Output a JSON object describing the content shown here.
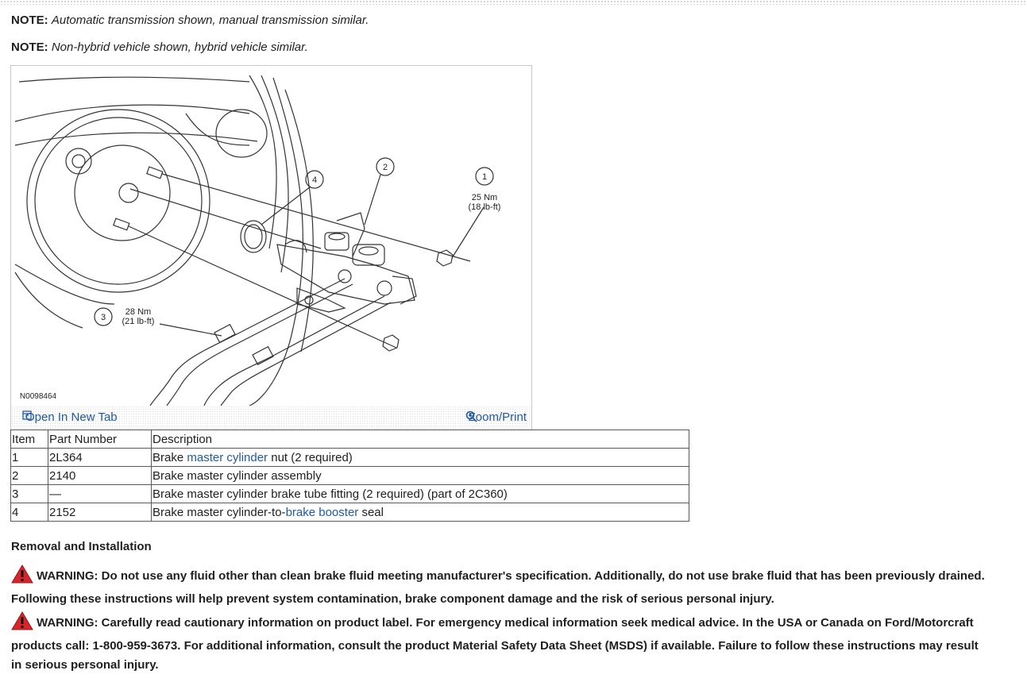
{
  "notes": [
    {
      "label": "NOTE:",
      "text": "Automatic transmission shown, manual transmission similar."
    },
    {
      "label": "NOTE:",
      "text": "Non-hybrid vehicle shown, hybrid vehicle similar."
    }
  ],
  "figure": {
    "figure_id": "N0098464",
    "callouts": {
      "c1": "1",
      "c2": "2",
      "c3": "3",
      "c4": "4",
      "torque1_nm": "25 Nm",
      "torque1_lbft": "(18 lb-ft)",
      "torque3_nm": "28 Nm",
      "torque3_lbft": "(21 lb-ft)"
    },
    "open_tab_label": "Open In New Tab",
    "zoom_print_label": "Zoom/Print"
  },
  "parts_table": {
    "headers": [
      "Item",
      "Part Number",
      "Description"
    ],
    "rows": [
      {
        "item": "1",
        "part": "2L364",
        "desc_pre": "Brake ",
        "desc_link": "master cylinder",
        "desc_post": " nut (2 required)"
      },
      {
        "item": "2",
        "part": "2140",
        "desc_pre": "Brake master cylinder assembly",
        "desc_link": "",
        "desc_post": ""
      },
      {
        "item": "3",
        "part": "—",
        "desc_pre": "Brake master cylinder brake tube fitting (2 required) (part of 2C360)",
        "desc_link": "",
        "desc_post": ""
      },
      {
        "item": "4",
        "part": "2152",
        "desc_pre": "Brake master cylinder-to-",
        "desc_link": "brake booster",
        "desc_post": " seal"
      }
    ]
  },
  "section_heading": "Removal and Installation",
  "warnings": [
    "WARNING: Do not use any fluid other than clean brake fluid meeting manufacturer's specification. Additionally, do not use brake fluid that has been previously drained. Following these instructions will help prevent system contamination, brake component damage and the risk of serious personal injury.",
    "WARNING: Carefully read cautionary information on product label. For emergency medical information seek medical advice. In the USA or Canada on Ford/Motorcraft products call: 1-800-959-3673. For additional information, consult the product Material Safety Data Sheet (MSDS) if available. Failure to follow these instructions may result in serious personal injury."
  ],
  "colors": {
    "link": "#1f5aa5",
    "warning_icon": "#d7262b",
    "text": "#1f1f1f"
  },
  "icons": {
    "open_tab": "open-new-tab-icon",
    "zoom": "magnifier-icon",
    "warning": "warning-triangle-icon"
  }
}
